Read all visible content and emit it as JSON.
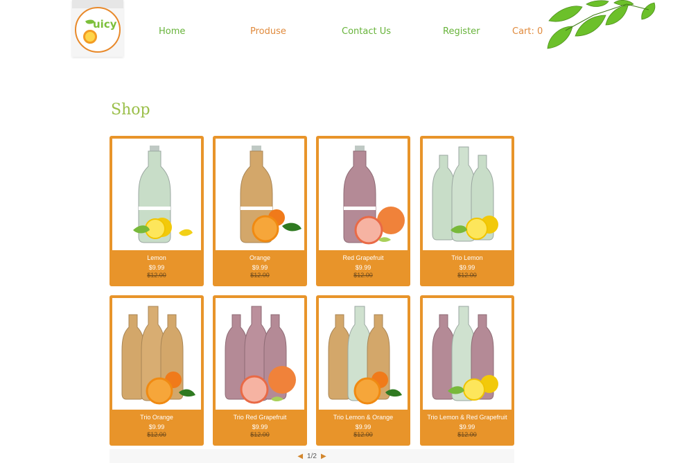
{
  "brand": {
    "logo_text": "uicy"
  },
  "nav": {
    "home": "Home",
    "produse": "Produse",
    "contact": "Contact Us",
    "register": "Register",
    "cart": "Cart: 0"
  },
  "shop": {
    "title": "Shop",
    "products": [
      {
        "name": "Lemon",
        "price": "$9.99",
        "old_price": "$12.00"
      },
      {
        "name": "Orange",
        "price": "$9.99",
        "old_price": "$12.00"
      },
      {
        "name": "Red Grapefruit",
        "price": "$9.99",
        "old_price": "$12.00"
      },
      {
        "name": "Trio Lemon",
        "price": "$9.99",
        "old_price": "$12.00"
      },
      {
        "name": "Trio Orange",
        "price": "$9.99",
        "old_price": "$12.00"
      },
      {
        "name": "Trio Red Grapefruit",
        "price": "$9.99",
        "old_price": "$12.00"
      },
      {
        "name": "Trio Lemon & Orange",
        "price": "$9.99",
        "old_price": "$12.00"
      },
      {
        "name": "Trio Lemon & Red Grapefruit",
        "price": "$9.99",
        "old_price": "$12.00"
      }
    ]
  },
  "pagination": {
    "prev_icon": "triangle-left-icon",
    "page": "1/2",
    "next_icon": "triangle-right-icon"
  },
  "colors": {
    "accent": "#e8942a",
    "nav_green": "#67b33a",
    "nav_orange": "#e08a3c",
    "title_green": "#9bbf4a"
  }
}
